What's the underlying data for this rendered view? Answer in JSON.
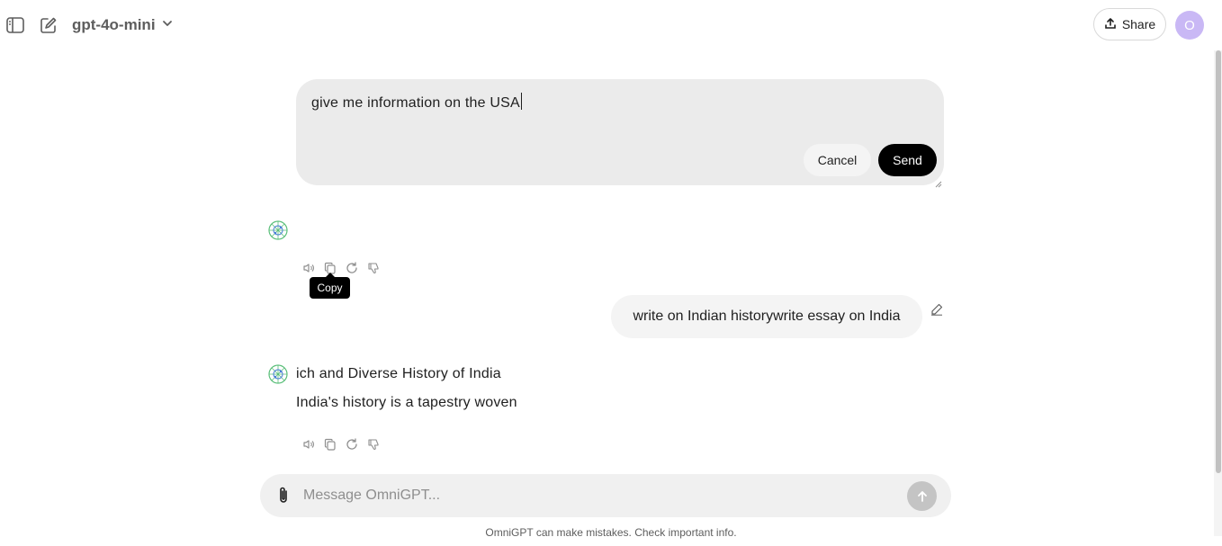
{
  "header": {
    "model_name": "gpt-4o-mini",
    "share_label": "Share",
    "avatar_initial": "O"
  },
  "edit": {
    "value": "give me information on the USA",
    "cancel_label": "Cancel",
    "send_label": "Send"
  },
  "tooltip": {
    "copy_label": "Copy"
  },
  "conversation": {
    "user_message": "write on Indian historywrite essay on India",
    "assistant_heading": "ich and Diverse History of India",
    "assistant_text": "India's history is a tapestry woven"
  },
  "composer": {
    "placeholder": "Message OmniGPT..."
  },
  "footer": {
    "note": "OmniGPT can make mistakes. Check important info."
  },
  "icons": {
    "sidebar": "sidebar-toggle-icon",
    "new_chat": "new-chat-icon",
    "model_dropdown": "chevron-down-icon",
    "share": "upload-icon",
    "read_aloud": "speaker-icon",
    "copy": "copy-icon",
    "regenerate": "refresh-icon",
    "bad_response": "thumbs-down-icon",
    "edit_message": "pencil-icon",
    "attach": "paperclip-icon",
    "send": "arrow-up-icon"
  },
  "colors": {
    "send_button": "#000000",
    "avatar": "#c9b8f5",
    "bot_logo": "#5bbf7a"
  }
}
